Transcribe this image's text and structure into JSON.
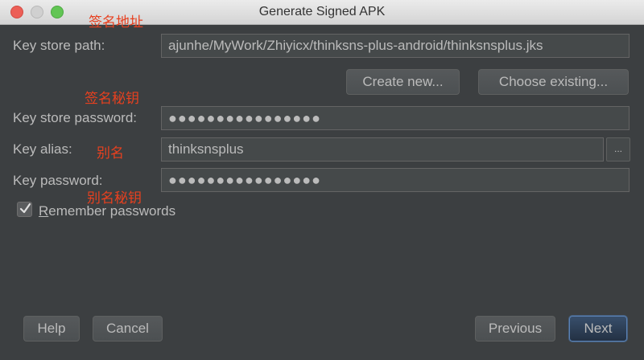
{
  "window": {
    "title": "Generate Signed APK"
  },
  "form": {
    "key_store_path": {
      "label": "Key store path:",
      "value": "ajunhe/MyWork/Zhiyicx/thinksns-plus-android/thinksnsplus.jks"
    },
    "create_new_label": "Create new...",
    "choose_existing_label": "Choose existing...",
    "key_store_password": {
      "label": "Key store password:",
      "value": "●●●●●●●●●●●●●●●●"
    },
    "key_alias": {
      "label": "Key alias:",
      "value": "thinksnsplus",
      "browse_label": "..."
    },
    "key_password": {
      "label": "Key password:",
      "value": "●●●●●●●●●●●●●●●●"
    },
    "remember_passwords": {
      "mnemonic": "R",
      "label_rest": "emember passwords",
      "checked": true
    }
  },
  "annotations": {
    "keystore_path_note": "签名地址",
    "keystore_password_note": "签名秘钥",
    "alias_note": "别名",
    "alias_password_note": "别名秘钥"
  },
  "footer": {
    "help_label": "Help",
    "cancel_label": "Cancel",
    "previous_label": "Previous",
    "next_label": "Next"
  },
  "colors": {
    "background": "#3c3f41",
    "annotation": "#e8401f",
    "default_button_border": "#5a81b4"
  }
}
